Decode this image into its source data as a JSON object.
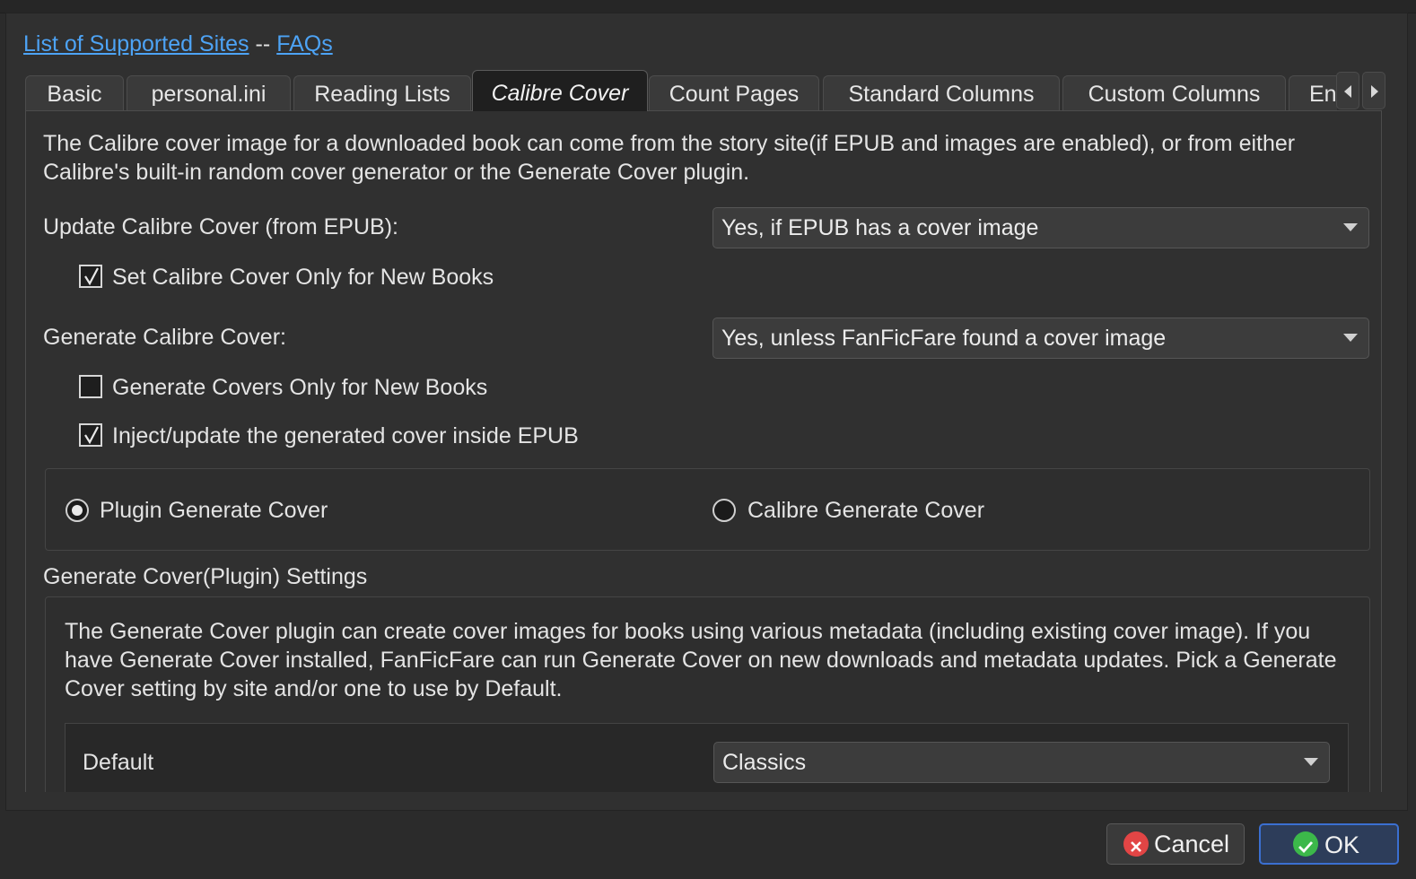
{
  "links": {
    "supported_sites": "List of Supported Sites",
    "separator": "--",
    "faqs": "FAQs"
  },
  "tabs": [
    {
      "label": "Basic",
      "active": false
    },
    {
      "label": "personal.ini",
      "active": false
    },
    {
      "label": "Reading Lists",
      "active": false
    },
    {
      "label": "Calibre Cover",
      "active": true
    },
    {
      "label": "Count Pages",
      "active": false
    },
    {
      "label": "Standard Columns",
      "active": false
    },
    {
      "label": "Custom Columns",
      "active": false
    },
    {
      "label": "En",
      "active": false
    }
  ],
  "tab_scroll": {
    "left_icon": "triangle-left-icon",
    "right_icon": "triangle-right-icon"
  },
  "cover_tab": {
    "intro": "The Calibre cover image for a downloaded book can come from the story site(if EPUB and images are enabled), or from either Calibre's built-in random cover generator or the Generate Cover plugin.",
    "update_cover_label": "Update Calibre Cover (from EPUB):",
    "update_cover_value": "Yes, if EPUB has a cover image",
    "set_cover_new_books": {
      "label": "Set Calibre Cover Only for New Books",
      "checked": true
    },
    "generate_cover_label": "Generate Calibre Cover:",
    "generate_cover_value": "Yes, unless FanFicFare found a cover image",
    "generate_new_books": {
      "label": "Generate Covers Only for New Books",
      "checked": false
    },
    "inject_cover": {
      "label": "Inject/update the generated cover inside EPUB",
      "checked": true
    },
    "radio_plugin": {
      "label": "Plugin Generate Cover",
      "checked": true
    },
    "radio_calibre": {
      "label": "Calibre Generate Cover",
      "checked": false
    },
    "plugin_settings_title": "Generate Cover(Plugin) Settings",
    "plugin_settings_desc": "The Generate Cover plugin can create cover images for books using various metadata (including existing cover image).  If you have Generate Cover installed, FanFicFare can run Generate Cover on new downloads and metadata updates.  Pick a Generate Cover setting by site and/or one to use by Default.",
    "default_label": "Default",
    "default_value": "Classics"
  },
  "buttons": {
    "cancel": {
      "label": "Cancel",
      "icon": "cancel-icon",
      "color": "#e24545"
    },
    "ok": {
      "label": "OK",
      "icon": "ok-check-icon",
      "color": "#3cb84a"
    }
  }
}
